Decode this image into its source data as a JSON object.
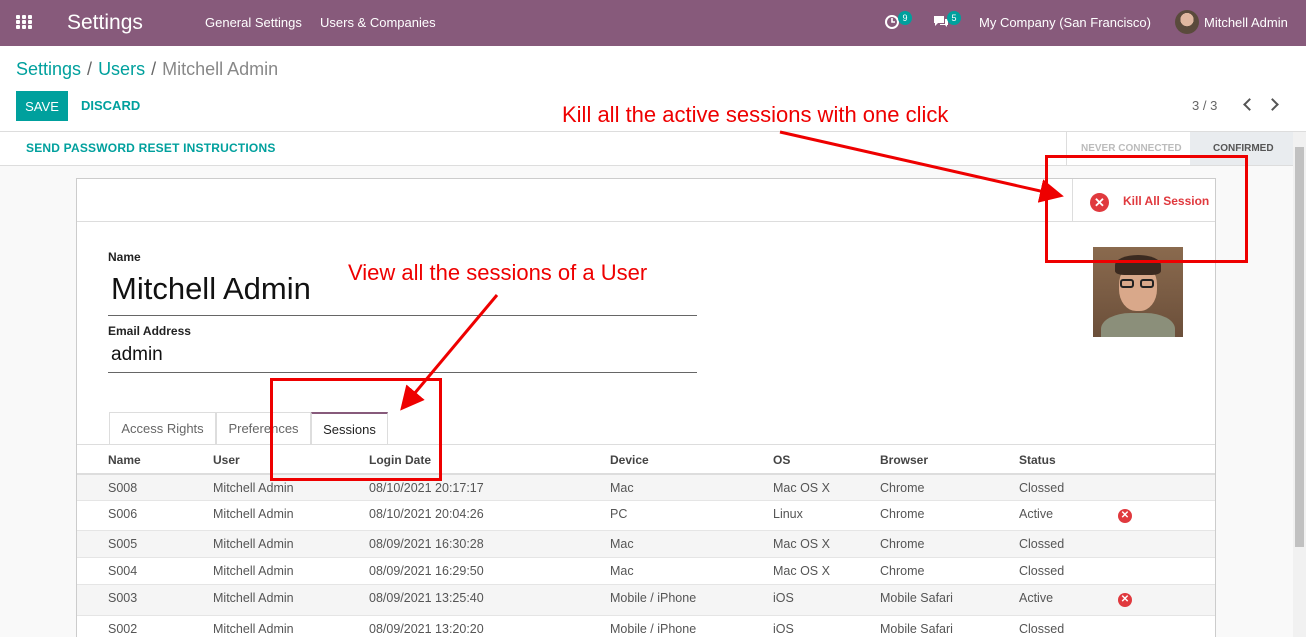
{
  "navbar": {
    "app_title": "Settings",
    "menu": [
      "General Settings",
      "Users & Companies"
    ],
    "activity_count": "9",
    "messages_count": "5",
    "company": "My Company (San Francisco)",
    "user": "Mitchell Admin"
  },
  "breadcrumb": {
    "root": "Settings",
    "users": "Users",
    "sep": "/",
    "current": "Mitchell Admin"
  },
  "buttons": {
    "save": "SAVE",
    "discard": "DISCARD",
    "send_reset": "SEND PASSWORD RESET INSTRUCTIONS",
    "kill_all": "Kill All Session"
  },
  "pager": "3 / 3",
  "stages": [
    "NEVER CONNECTED",
    "CONFIRMED"
  ],
  "form": {
    "name_label": "Name",
    "name_value": "Mitchell Admin",
    "email_label": "Email Address",
    "email_value": "admin"
  },
  "tabs": [
    "Access Rights",
    "Preferences",
    "Sessions"
  ],
  "sessions": {
    "columns": [
      "Name",
      "User",
      "Login Date",
      "Device",
      "OS",
      "Browser",
      "Status"
    ],
    "rows": [
      [
        "S008",
        "Mitchell Admin",
        "08/10/2021 20:17:17",
        "Mac",
        "Mac OS X",
        "Chrome",
        "Clossed",
        false
      ],
      [
        "S006",
        "Mitchell Admin",
        "08/10/2021 20:04:26",
        "PC",
        "Linux",
        "Chrome",
        "Active",
        true
      ],
      [
        "S005",
        "Mitchell Admin",
        "08/09/2021 16:30:28",
        "Mac",
        "Mac OS X",
        "Chrome",
        "Clossed",
        false
      ],
      [
        "S004",
        "Mitchell Admin",
        "08/09/2021 16:29:50",
        "Mac",
        "Mac OS X",
        "Chrome",
        "Clossed",
        false
      ],
      [
        "S003",
        "Mitchell Admin",
        "08/09/2021 13:25:40",
        "Mobile / iPhone",
        "iOS",
        "Mobile Safari",
        "Active",
        true
      ],
      [
        "S002",
        "Mitchell Admin",
        "08/09/2021 13:20:20",
        "Mobile / iPhone",
        "iOS",
        "Mobile Safari",
        "Clossed",
        false
      ]
    ]
  },
  "annotations": {
    "kill": "Kill all the active sessions with one click",
    "view": "View all the sessions of a User"
  },
  "colors": {
    "brand": "#875a7b",
    "accent": "#00a09d",
    "annotation": "#ee0000",
    "danger": "#e0393e"
  }
}
